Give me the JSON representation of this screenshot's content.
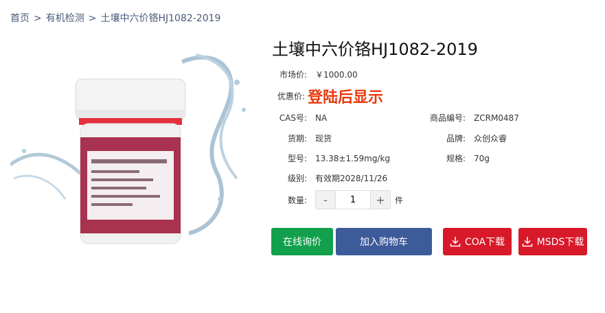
{
  "breadcrumb": {
    "home": "首页",
    "separator": ">",
    "category": "有机检测",
    "current": "土壤中六价铬HJ1082-2019"
  },
  "product": {
    "title": "土壤中六价铬HJ1082-2019",
    "market_price_label": "市场价:",
    "market_price": "￥1000.00",
    "promo_label": "优惠价:",
    "promo_value": "登陆后显示",
    "cas_label": "CAS号:",
    "cas": "NA",
    "code_label": "商品编号:",
    "code": "ZCRM0487",
    "stock_label": "货期:",
    "stock": "现货",
    "brand_label": "品牌:",
    "brand": "众创众睿",
    "model_label": "型号:",
    "model": "13.38±1.59mg/kg",
    "spec_label": "规格:",
    "spec": "70g",
    "level_label": "级别:",
    "level": "有效期2028/11/26",
    "qty_label": "数量:",
    "qty": "1",
    "qty_unit": "件",
    "minus": "-",
    "plus": "+"
  },
  "buttons": {
    "inquiry": "在线询价",
    "cart": "加入购物车",
    "coa": "COA下载",
    "msds": "MSDS下载"
  },
  "colors": {
    "accent_red": "#e8380d",
    "inquiry_green": "#12a04c",
    "cart_blue": "#3d5a99",
    "download_red": "#d7192a"
  }
}
